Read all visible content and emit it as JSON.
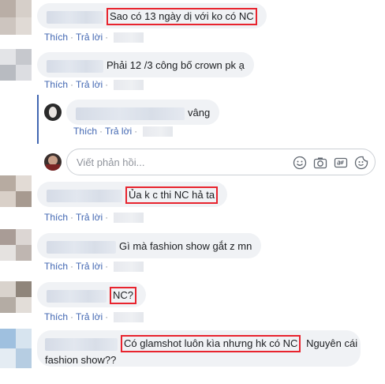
{
  "actions": {
    "like": "Thích",
    "reply": "Trả lời",
    "separator": "·"
  },
  "comments": [
    {
      "text": "Sao có 13 ngày dị với ko có NC"
    },
    {
      "text": "Phải 12 /3 công bố crown pk ạ"
    },
    {
      "text": "vâng"
    },
    {
      "text": "Ủa k c thi NC hả ta"
    },
    {
      "text": "Gì mà fashion show gắt z mn"
    },
    {
      "text": "NC?"
    },
    {
      "text_highlight": "Có glamshot luôn kìa nhưng hk có NC",
      "text_rest_1": "Nguyên cái",
      "text_rest_2": "fashion show??"
    }
  ],
  "reply_box": {
    "placeholder": "Viết phản hồi...",
    "icons": [
      "emoji-icon",
      "camera-icon",
      "gif-icon",
      "sticker-icon"
    ]
  },
  "colors": {
    "highlight_border": "#e8242e",
    "link": "#4267b2",
    "bubble": "#f0f2f5"
  }
}
